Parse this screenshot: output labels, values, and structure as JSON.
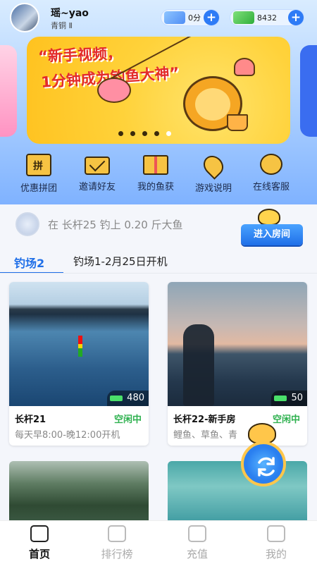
{
  "header": {
    "username": "瑶~yao",
    "level": "青铜 Ⅱ",
    "score_value": "0分",
    "energy_value": "8432",
    "score_icon": "gold-coin-icon",
    "energy_icon": "battery-bolt-icon"
  },
  "banner": {
    "line1": "“新手视频，",
    "line2": "1分钟成为钓鱼大神”",
    "slide_count": 5,
    "active_slide": 4
  },
  "quick_nav": {
    "items": [
      {
        "label": "优惠拼团",
        "icon": "group-buy-bag-icon"
      },
      {
        "label": "邀请好友",
        "icon": "envelope-icon"
      },
      {
        "label": "我的鱼获",
        "icon": "gift-box-icon"
      },
      {
        "label": "游戏说明",
        "icon": "location-pin-icon"
      },
      {
        "label": "在线客服",
        "icon": "customer-service-icon"
      }
    ]
  },
  "notice": {
    "text": "在 长杆25 钓上 0.20 斤大鱼",
    "button": "进入房间"
  },
  "tabs": {
    "active": "钓场2",
    "inactive": "钓场1-2月25日开机"
  },
  "rooms": [
    {
      "name": "长杆21",
      "status": "空闲中",
      "count": "480",
      "desc": "每天早8:00-晚12:00开机"
    },
    {
      "name": "长杆22-新手房",
      "status": "空闲中",
      "count": "50",
      "desc": "鲤鱼、草鱼、青"
    }
  ],
  "tabbar": {
    "items": [
      {
        "label": "首页",
        "icon": "home-icon",
        "active": true
      },
      {
        "label": "排行榜",
        "icon": "trophy-icon",
        "active": false
      },
      {
        "label": "充值",
        "icon": "wallet-icon",
        "active": false
      },
      {
        "label": "我的",
        "icon": "profile-icon",
        "active": false
      }
    ]
  },
  "colors": {
    "accent": "#1f6fe8",
    "status_green": "#2eb14f",
    "banner_text": "#e32b2b"
  }
}
